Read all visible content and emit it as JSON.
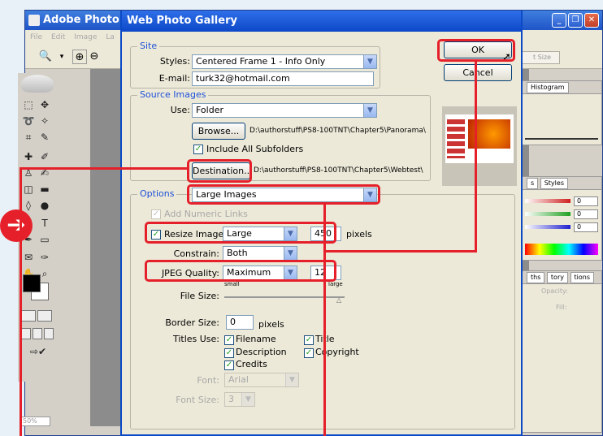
{
  "photoshop": {
    "title": "Adobe Photo",
    "menu": [
      "File",
      "Edit",
      "Image",
      "La"
    ],
    "fit_size": "t Size",
    "zoom": "50%",
    "histogram_tab": "Histogram",
    "color_tabs": [
      "s",
      "Styles"
    ],
    "color_values": [
      "0",
      "0",
      "0"
    ],
    "layers_tabs": [
      "ths",
      "tory",
      "tions"
    ],
    "opacity_label": "Opacity:",
    "fill_label": "Fill:"
  },
  "dialog": {
    "title": "Web Photo Gallery",
    "ok_label": "OK",
    "cancel_label": "Cancel",
    "site": {
      "group_label": "Site",
      "styles_label": "Styles:",
      "styles_value": "Centered Frame 1 - Info Only",
      "email_label": "E-mail:",
      "email_value": "turk32@hotmail.com"
    },
    "source": {
      "group_label": "Source Images",
      "use_label": "Use:",
      "use_value": "Folder",
      "browse_label": "Browse...",
      "browse_path": "D:\\authorstuff\\PS8-100TNT\\Chapter5\\Panorama\\",
      "include_subfolders": "Include All Subfolders",
      "destination_label": "Destination...",
      "destination_path": "D:\\authorstuff\\PS8-100TNT\\Chapter5\\Webtest\\"
    },
    "options": {
      "group_label": "Options",
      "value": "Large Images",
      "add_numeric_links": "Add Numeric Links",
      "resize_label": "Resize Images:",
      "resize_value": "Large",
      "resize_pixels": "450",
      "pixels_unit": "pixels",
      "constrain_label": "Constrain:",
      "constrain_value": "Both",
      "jpeg_label": "JPEG Quality:",
      "jpeg_value": "Maximum",
      "jpeg_number": "12",
      "file_size_label": "File Size:",
      "small_label": "small",
      "large_label": "large",
      "border_label": "Border Size:",
      "border_value": "0",
      "border_unit": "pixels",
      "titles_use_label": "Titles Use:",
      "title_filename": "Filename",
      "title_title": "Title",
      "title_description": "Description",
      "title_copyright": "Copyright",
      "title_credits": "Credits",
      "font_label": "Font:",
      "font_value": "Arial",
      "font_size_label": "Font Size:",
      "font_size_value": "3"
    }
  },
  "colors": {
    "highlight": "#e5202a",
    "title_blue": "#0c48c8",
    "group_label": "#1e50d8"
  }
}
